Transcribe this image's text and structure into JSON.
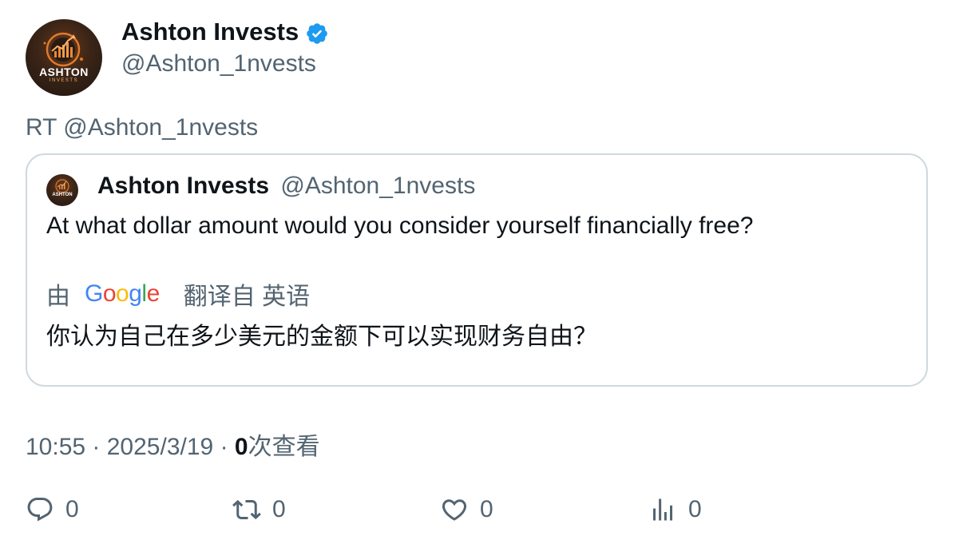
{
  "author": {
    "display_name": "Ashton Invests",
    "handle": "@Ashton_1nvests",
    "verified_icon": "verified-badge-icon",
    "avatar_logo_text": "ASHTON",
    "avatar_logo_subtext": "INVESTS"
  },
  "retweet_line": "RT @Ashton_1nvests",
  "quoted_tweet": {
    "display_name": "Ashton Invests",
    "handle": "@Ashton_1nvests",
    "avatar_logo_text": "ASHTON",
    "text": "At what dollar amount would you consider yourself financially free?",
    "translation": {
      "by_label": "由",
      "provider": "Google",
      "translated_from_label": "翻译自 英语",
      "translated_text": "你认为自己在多少美元的金额下可以实现财务自由？"
    }
  },
  "meta": {
    "time": "10:55",
    "separator": "·",
    "date": "2025/3/19",
    "views_count": "0",
    "views_label": "次查看"
  },
  "actions": {
    "reply_count": "0",
    "retweet_count": "0",
    "like_count": "0",
    "views_count": "0"
  },
  "colors": {
    "text_primary": "#0f1419",
    "text_secondary": "#536471",
    "verified": "#1d9bf0",
    "border": "#cfd9de"
  }
}
